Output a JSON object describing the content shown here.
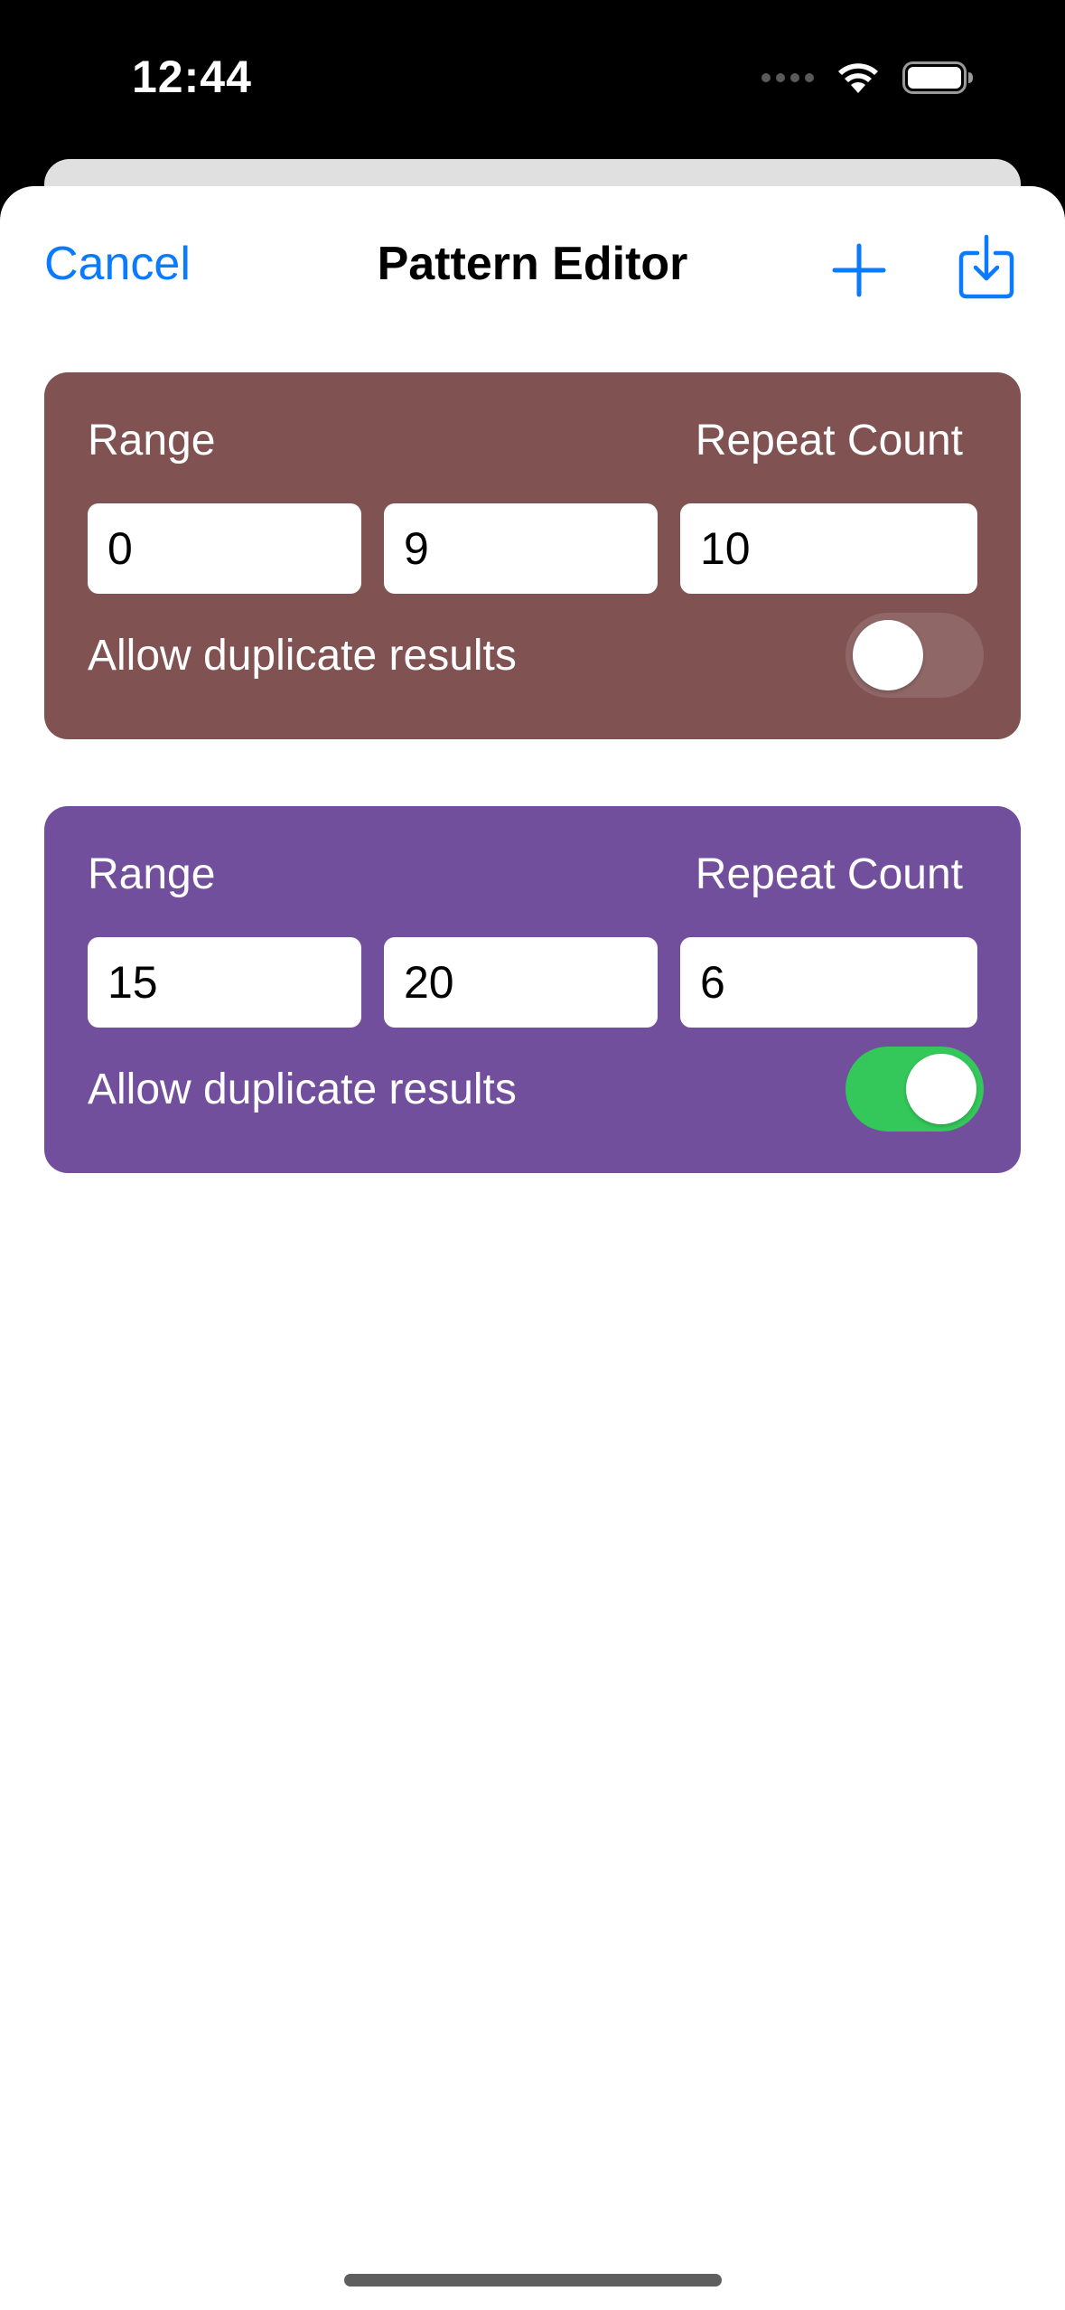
{
  "status_bar": {
    "time": "12:44",
    "icons": [
      "signal-dots-icon",
      "wifi-icon",
      "battery-icon"
    ]
  },
  "nav": {
    "cancel_label": "Cancel",
    "title": "Pattern Editor",
    "add_icon": "plus-icon",
    "export_icon": "square-arrow-down-icon",
    "accent_color": "#0A7AFF"
  },
  "patterns": [
    {
      "color": "#805252",
      "range_label": "Range",
      "repeat_label": "Repeat Count",
      "range_min": "0",
      "range_max": "9",
      "repeat_count": "10",
      "allow_duplicates_label": "Allow duplicate results",
      "allow_duplicates": false
    },
    {
      "color": "#724F9C",
      "range_label": "Range",
      "repeat_label": "Repeat Count",
      "range_min": "15",
      "range_max": "20",
      "repeat_count": "6",
      "allow_duplicates_label": "Allow duplicate results",
      "allow_duplicates": true
    }
  ],
  "toggle_colors": {
    "on": "#34C759",
    "off": "rgba(255,255,255,0.12)"
  }
}
